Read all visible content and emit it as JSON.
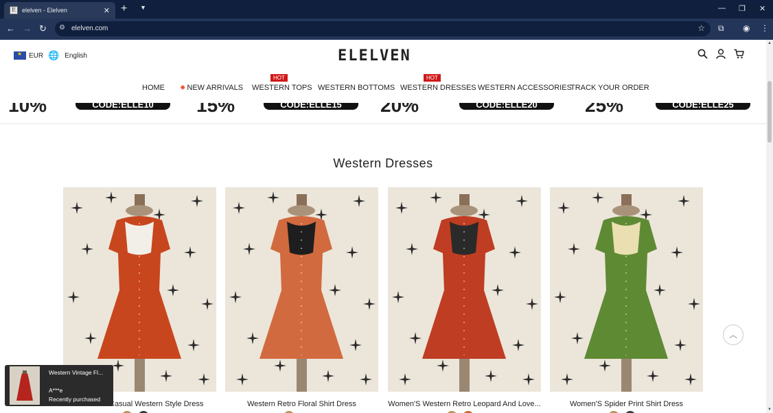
{
  "browser": {
    "tab_title": "elelven - Elelven",
    "favicon_letter": "E",
    "url": "elelven.com"
  },
  "header": {
    "currency": "EUR",
    "language": "English",
    "logo": "ELELVEN"
  },
  "nav": {
    "items": [
      {
        "label": "HOME"
      },
      {
        "label": "NEW ARRIVALS"
      },
      {
        "label": "WESTERN TOPS",
        "badge": "HOT"
      },
      {
        "label": "WESTERN BOTTOMS"
      },
      {
        "label": "WESTERN DRESSES",
        "badge": "HOT"
      },
      {
        "label": "WESTERN ACCESSORIES"
      },
      {
        "label": "TRACK YOUR ORDER"
      }
    ]
  },
  "promo": {
    "items": [
      {
        "pct": "10%",
        "code": "CODE:ELLE10"
      },
      {
        "pct": "15%",
        "code": "CODE:ELLE15"
      },
      {
        "pct": "20%",
        "code": "CODE:ELLE20"
      },
      {
        "pct": "25%",
        "code": "CODE:ELLE25"
      }
    ]
  },
  "section": {
    "title": "Western Dresses"
  },
  "products": [
    {
      "name": "Women's Casual Western Style Dress",
      "color": "#c8461e",
      "yoke": "#f2efe8",
      "swatches": [
        "#b8955a",
        "#3a3a3a"
      ]
    },
    {
      "name": "Western Retro Floral Shirt Dress",
      "color": "#d26a3f",
      "yoke": "#1e1e1e",
      "swatches": [
        "#b8955a"
      ]
    },
    {
      "name": "Women'S Western Retro Leopard And Love...",
      "color": "#bf3d22",
      "yoke": "#2a2a2a",
      "swatches": [
        "#b8955a",
        "#c86b3a"
      ]
    },
    {
      "name": "Women'S Spider Print Shirt Dress",
      "color": "#5f8a34",
      "yoke": "#eadfb0",
      "swatches": [
        "#b8955a",
        "#3a3a3a"
      ]
    }
  ],
  "toast": {
    "product": "Western Vintage Fl...",
    "buyer": "A***e",
    "status": "Recently purchased"
  }
}
